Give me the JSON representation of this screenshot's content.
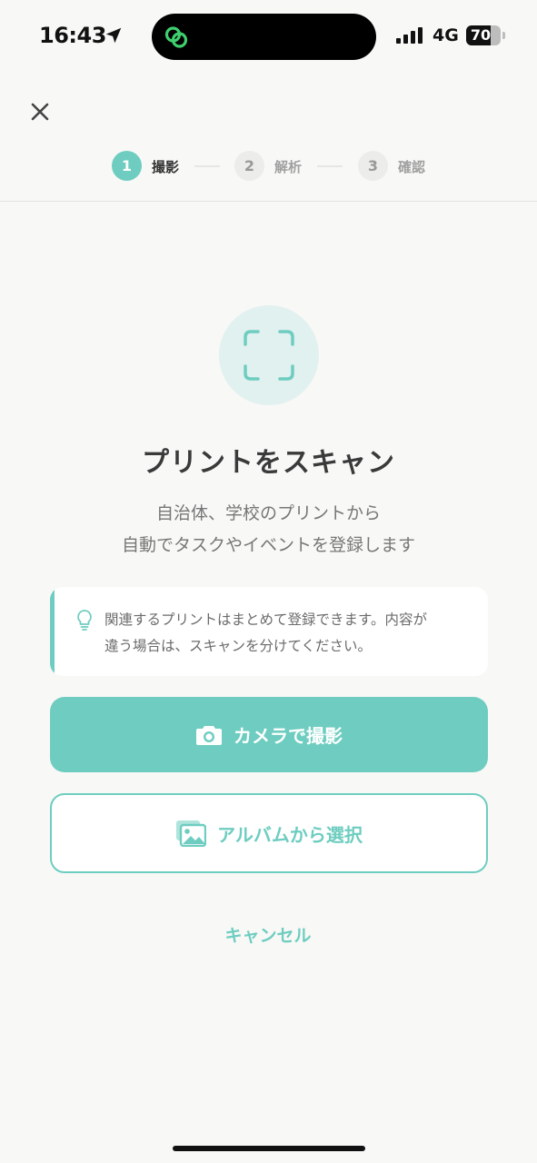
{
  "status_bar": {
    "time": "16:43",
    "location_icon": "location-arrow-icon",
    "island_icon": "linked-rings-app-icon",
    "island_icon_color": "#3fcf6e",
    "network": "4G",
    "battery_level": "70",
    "battery_fraction": 0.7
  },
  "header": {
    "close_icon": "close-icon",
    "steps": [
      {
        "number": "1",
        "label": "撮影",
        "state": "active"
      },
      {
        "number": "2",
        "label": "解析",
        "state": "inactive"
      },
      {
        "number": "3",
        "label": "確認",
        "state": "inactive"
      }
    ]
  },
  "main": {
    "scan_icon": "scan-frame-icon",
    "title": "プリントをスキャン",
    "subtitle_lines": [
      "自治体、学校のプリントから",
      "自動でタスクやイベントを登録します"
    ],
    "tip": {
      "icon": "lightbulb-icon",
      "lines": [
        "関連するプリントはまとめて登録できます。内容が",
        "違う場合は、スキャンを分けてください。"
      ]
    },
    "camera_button": {
      "icon": "camera-icon",
      "label": "カメラで撮影"
    },
    "album_button": {
      "icon": "photo-album-icon",
      "label": "アルバムから選択"
    },
    "cancel_label": "キャンセル"
  },
  "colors": {
    "accent": "#6ecdc0",
    "accent_light": "#e1f1ef",
    "background": "#f8f8f6",
    "text_primary": "#3a3a3a",
    "text_secondary": "#777777"
  }
}
